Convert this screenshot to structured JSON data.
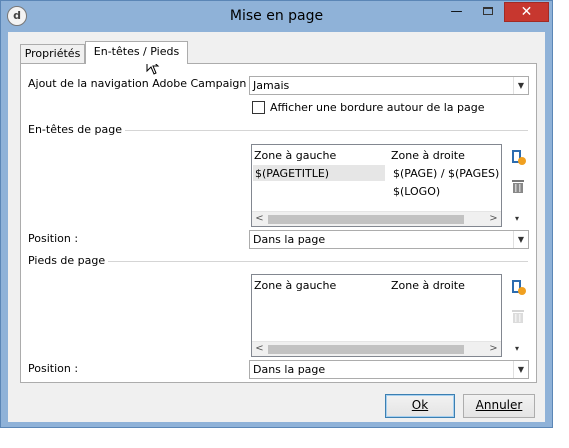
{
  "window": {
    "title": "Mise en page",
    "app_icon_glyph": "d",
    "minimize_glyph": "—",
    "close_glyph": "✕"
  },
  "tabs": [
    {
      "label": "Propriétés",
      "active": false
    },
    {
      "label": "En-têtes / Pieds",
      "active": true
    }
  ],
  "navigation": {
    "label": "Ajout de la navigation Adobe Campaign :",
    "value": "Jamais",
    "border_checkbox_label": "Afficher une bordure autour de la page",
    "border_checked": false
  },
  "headers": {
    "group_title": "En-têtes de page",
    "columns": [
      "Zone à gauche",
      "Zone à droite"
    ],
    "rows": [
      [
        "$(PAGETITLE)",
        "$(PAGE) / $(PAGES)"
      ],
      [
        "",
        "$(LOGO)"
      ]
    ],
    "position_label": "Position :",
    "position_value": "Dans la page"
  },
  "footers": {
    "group_title": "Pieds de page",
    "columns": [
      "Zone à gauche",
      "Zone à droite"
    ],
    "rows": [],
    "position_label": "Position :",
    "position_value": "Dans la page"
  },
  "buttons": {
    "ok": "Ok",
    "cancel": "Annuler"
  },
  "icons": {
    "add": "add-icon",
    "delete": "trash-icon",
    "dropdown": "chevron-down-icon"
  },
  "colors": {
    "title_bar": "#8fb2d8",
    "close_button": "#c7372f",
    "selection": "#e6e6e6"
  }
}
